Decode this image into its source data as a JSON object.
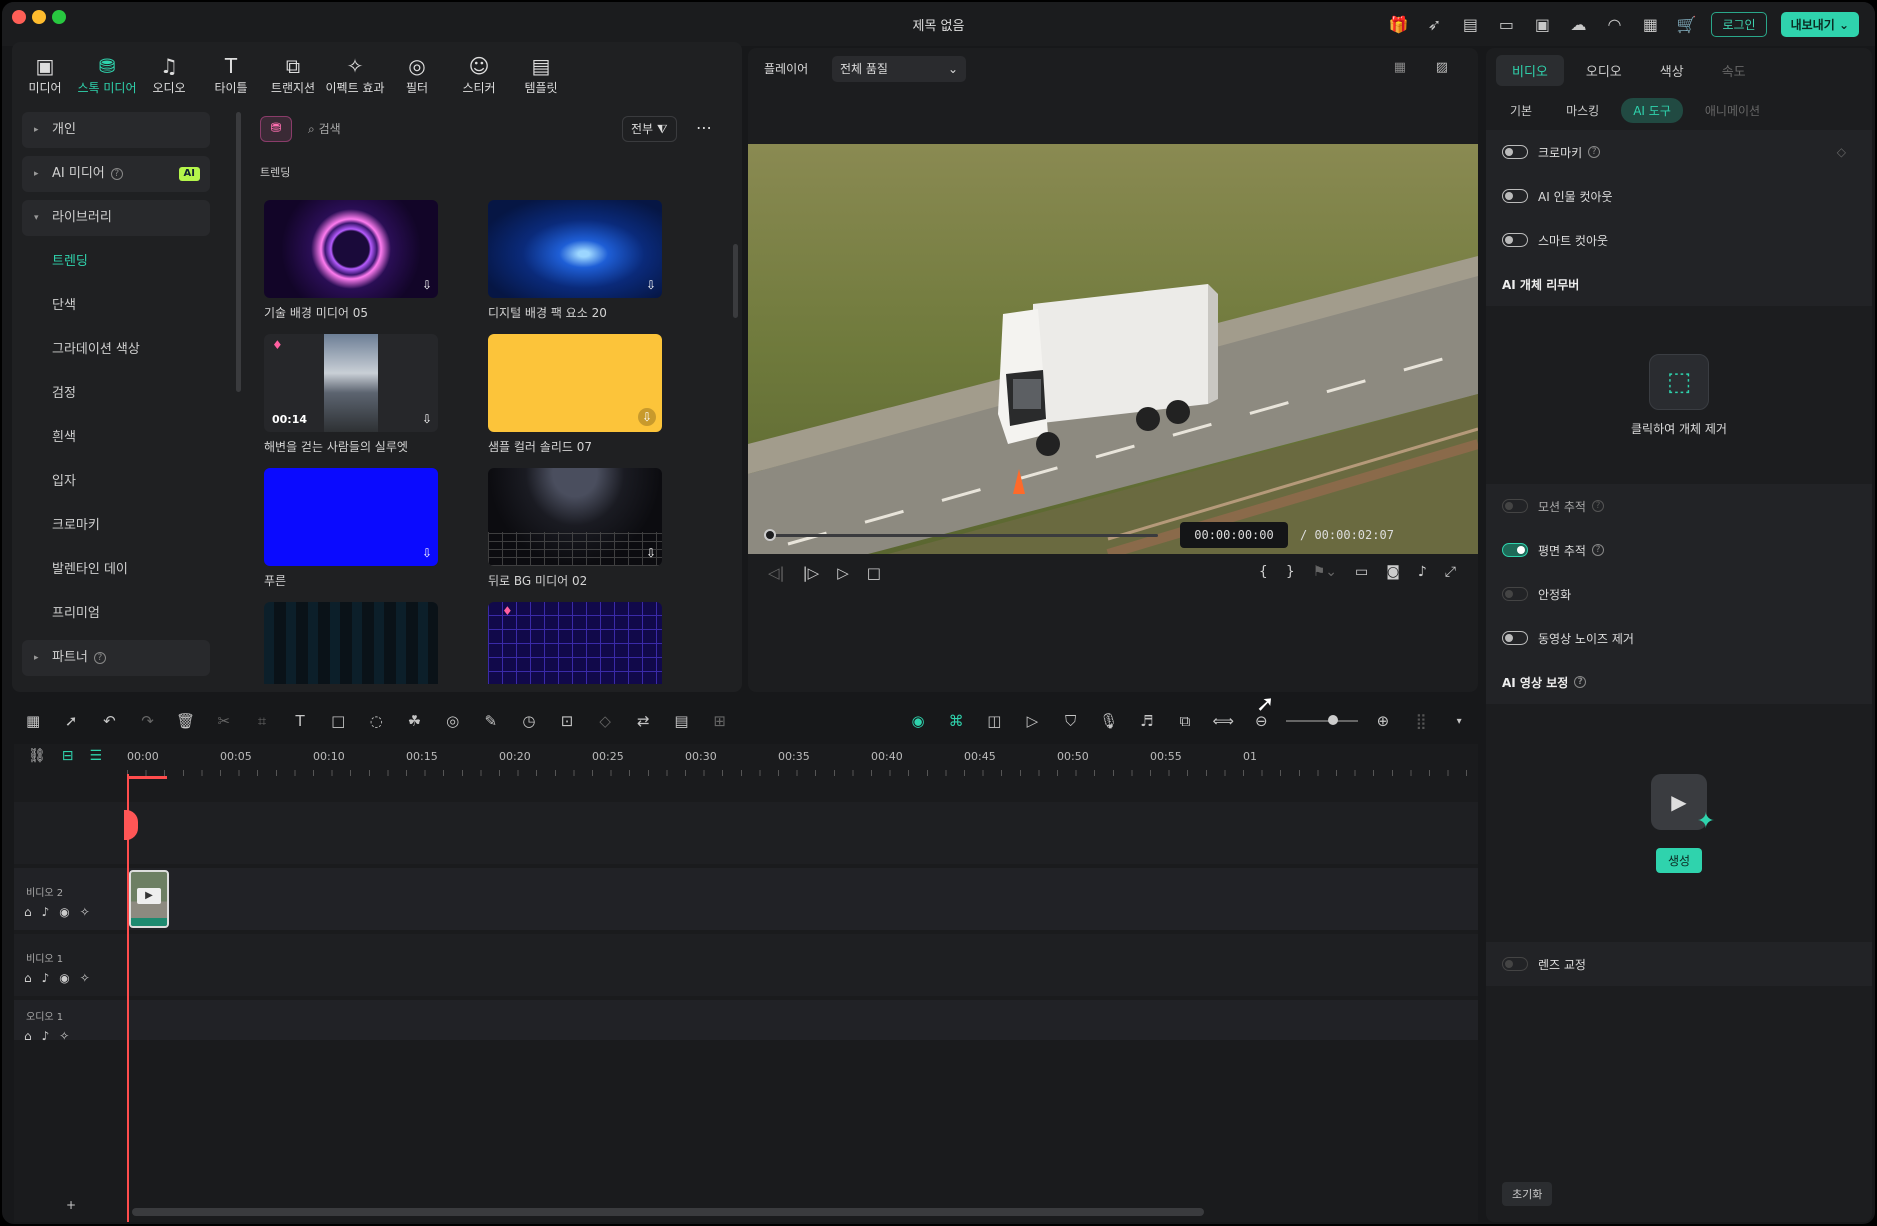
{
  "window": {
    "title": "제목 없음"
  },
  "header": {
    "login_label": "로그인",
    "export_label": "내보내기"
  },
  "top_toolbar": [
    {
      "label": "미디어",
      "icon": "media-icon"
    },
    {
      "label": "스톡 미디어",
      "icon": "stock-media-icon"
    },
    {
      "label": "오디오",
      "icon": "audio-icon"
    },
    {
      "label": "타이틀",
      "icon": "title-icon"
    },
    {
      "label": "트랜지션",
      "icon": "transition-icon"
    },
    {
      "label": "이펙트 효과",
      "icon": "effects-icon"
    },
    {
      "label": "필터",
      "icon": "filter-icon"
    },
    {
      "label": "스티커",
      "icon": "sticker-icon"
    },
    {
      "label": "템플릿",
      "icon": "template-icon"
    }
  ],
  "sidebar": {
    "personal": "개인",
    "ai_media": "AI 미디어",
    "ai_badge": "AI",
    "library": "라이브러리",
    "library_items": [
      "트렌딩",
      "단색",
      "그라데이션 색상",
      "검정",
      "흰색",
      "입자",
      "크로마키",
      "발렌타인 데이",
      "프리미엄"
    ],
    "partner": "파트너"
  },
  "media": {
    "search_placeholder": "검색",
    "filter_label": "전부",
    "section": "트렌딩",
    "items": [
      {
        "label": "기술 배경 미디어 05"
      },
      {
        "label": "디지털 배경 팩 요소 20"
      },
      {
        "label": "해변을 걷는 사람들의 실루엣",
        "duration": "00:14"
      },
      {
        "label": "샘플 컬러 솔리드 07"
      },
      {
        "label": "푸른"
      },
      {
        "label": "뒤로 BG 미디어 02"
      }
    ]
  },
  "player": {
    "label": "플레이어",
    "quality": "전체 품질",
    "current_time": "00:00:00:00",
    "total_time": "/ 00:00:02:07"
  },
  "right_panel": {
    "tabs": [
      "비디오",
      "오디오",
      "색상",
      "속도"
    ],
    "subtabs": [
      "기본",
      "마스킹",
      "AI 도구",
      "애니메이션"
    ],
    "chroma_key": "크로마키",
    "ai_person_cutout": "AI 인물 컷아웃",
    "smart_cutout": "스마트 컷아웃",
    "ai_object_remover": "AI 개체 리무버",
    "click_remove": "클릭하여 개체 제거",
    "motion_tracking": "모션 추적",
    "planar_tracking": "평면 추적",
    "stabilization": "안정화",
    "denoise": "동영상 노이즈 제거",
    "ai_video_enhance": "AI 영상 보정",
    "generate": "생성",
    "lens_correction": "렌즈 교정",
    "reset": "초기화"
  },
  "timeline": {
    "ticks": [
      "00:00",
      "00:05",
      "00:10",
      "00:15",
      "00:20",
      "00:25",
      "00:30",
      "00:35",
      "00:40",
      "00:45",
      "00:50",
      "00:55",
      "01"
    ],
    "tracks": [
      "비디오 2",
      "비디오 1",
      "오디오 1"
    ]
  }
}
